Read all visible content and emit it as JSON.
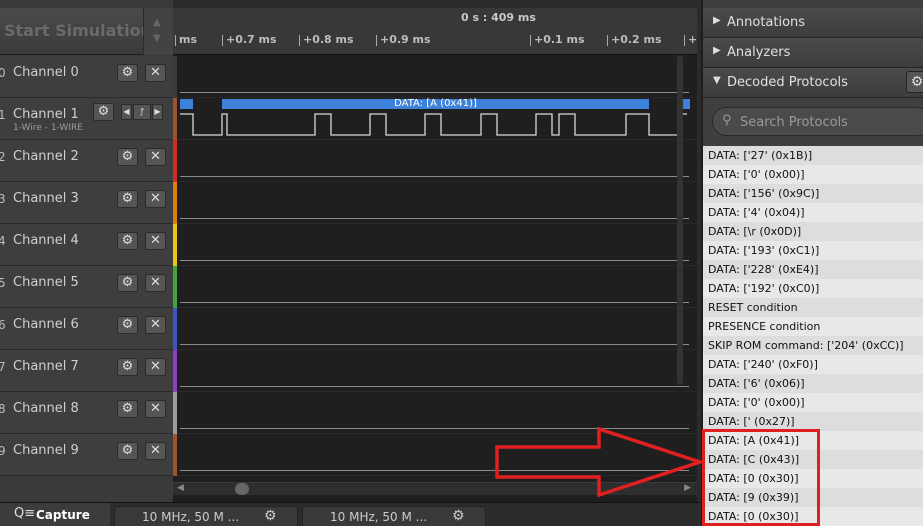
{
  "toolbar": {
    "start_simulation": "Start Simulation"
  },
  "time_header": {
    "center_time": "0 s : 409 ms",
    "ticks": [
      "ms",
      "+0.7 ms",
      "+0.8 ms",
      "+0.9 ms",
      "+0.1 ms",
      "+0.2 ms",
      "+"
    ]
  },
  "channels": [
    {
      "num": "0",
      "name": "Channel 0",
      "color": "#3a3a3a"
    },
    {
      "num": "1",
      "name": "Channel 1",
      "sub": "1-Wire - 1-WIRE",
      "color": "#a0522d"
    },
    {
      "num": "2",
      "name": "Channel 2",
      "color": "#d42a2a"
    },
    {
      "num": "3",
      "name": "Channel 3",
      "color": "#e07b16"
    },
    {
      "num": "4",
      "name": "Channel 4",
      "color": "#e6c619"
    },
    {
      "num": "5",
      "name": "Channel 5",
      "color": "#3fa53f"
    },
    {
      "num": "6",
      "name": "Channel 6",
      "color": "#3b53c6"
    },
    {
      "num": "7",
      "name": "Channel 7",
      "color": "#8c3fbf"
    },
    {
      "num": "8",
      "name": "Channel 8",
      "color": "#9c9c9c"
    },
    {
      "num": "9",
      "name": "Channel 9",
      "color": "#a0522d"
    }
  ],
  "channel1_tools": {
    "trigger_label": "ƒ"
  },
  "protocol_bar": {
    "label": "DATA: [A (0x41)]",
    "color": "#3d82d8"
  },
  "bottom_tabs": {
    "capture": "Capture",
    "tab1": "10 MHz, 50 M ...",
    "tab2": "10 MHz, 50 M ..."
  },
  "right_panel": {
    "annotations": "Annotations",
    "analyzers": "Analyzers",
    "decoded_protocols": "Decoded Protocols",
    "search_placeholder": "Search Protocols",
    "results": [
      "DATA: ['27' (0x1B)]",
      "DATA: ['0' (0x00)]",
      "DATA: ['156' (0x9C)]",
      "DATA: ['4' (0x04)]",
      "DATA: [\\r (0x0D)]",
      "DATA: ['193' (0xC1)]",
      "DATA: ['228' (0xE4)]",
      "DATA: ['192' (0xC0)]",
      "RESET condition",
      "PRESENCE condition",
      "SKIP ROM command: ['204' (0xCC)]",
      "DATA: ['240' (0xF0)]",
      "DATA: ['6' (0x06)]",
      "DATA: ['0' (0x00)]",
      "DATA: [' (0x27)]",
      "DATA: [A (0x41)]",
      "DATA: [C (0x43)]",
      "DATA: [0 (0x30)]",
      "DATA: [9 (0x39)]",
      "DATA: [0 (0x30)]"
    ]
  },
  "annotation_color": "#e02020"
}
